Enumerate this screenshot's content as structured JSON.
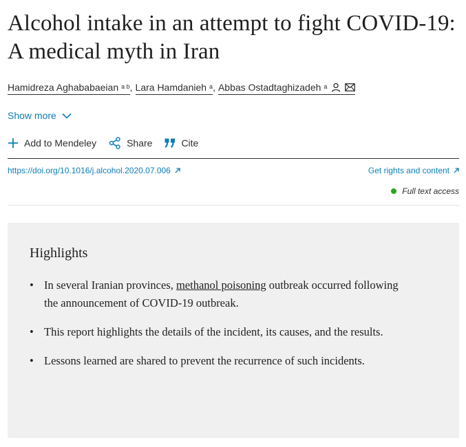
{
  "article": {
    "title": "Alcohol intake in an attempt to fight COVID-19: A medical myth in Iran"
  },
  "authors": [
    {
      "name": "Hamidreza Aghababaeian",
      "sup": "a b"
    },
    {
      "name": "Lara Hamdanieh",
      "sup": "a"
    },
    {
      "name": "Abbas Ostadtaghizadeh",
      "sup": "a"
    }
  ],
  "authors_separator": ",",
  "show_more": {
    "label": "Show more"
  },
  "actions": {
    "mendeley": "Add to Mendeley",
    "share": "Share",
    "cite": "Cite"
  },
  "links": {
    "doi": "https://doi.org/10.1016/j.alcohol.2020.07.006",
    "rights": "Get rights and content",
    "access": "Full text access"
  },
  "highlights": {
    "heading": "Highlights",
    "item1_before": "In several Iranian provinces, ",
    "item1_link": "methanol poisoning",
    "item1_after": " outbreak occurred following the announcement of COVID-19 outbreak.",
    "item2": "This report highlights the details of the incident, its causes, and the results.",
    "item3": "Lessons learned are shared to prevent the recurrence of such incidents.",
    "bullet": "•"
  },
  "colors": {
    "link": "#0c7dbb",
    "access_dot": "#29a61b",
    "highlights_bg": "#f0f0f0"
  },
  "icons": {
    "author": "person-icon",
    "email": "envelope-icon",
    "show_more": "chevron-down-icon",
    "mendeley": "plus-icon",
    "share": "share-icon",
    "cite": "quote-icon",
    "external": "external-arrow-icon"
  }
}
